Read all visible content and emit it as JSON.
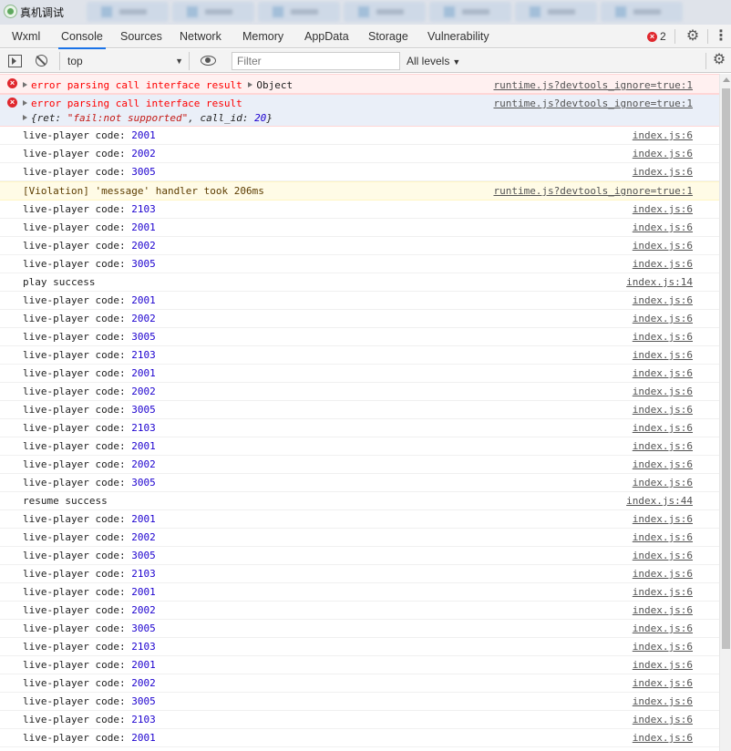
{
  "window": {
    "title": "真机调试"
  },
  "tabs": [
    {
      "label": "Wxml"
    },
    {
      "label": "Console"
    },
    {
      "label": "Sources"
    },
    {
      "label": "Network"
    },
    {
      "label": "Memory"
    },
    {
      "label": "AppData"
    },
    {
      "label": "Storage"
    },
    {
      "label": "Vulnerability"
    }
  ],
  "active_tab": "Console",
  "error_count": "2",
  "toolbar": {
    "context": "top",
    "filter_placeholder": "Filter",
    "levels": "All levels"
  },
  "messages": {
    "error1": {
      "text": "error parsing call interface result",
      "object": "Object",
      "source": "runtime.js?devtools_ignore=true:1"
    },
    "error2": {
      "text": "error parsing call interface result",
      "obj_ret_key": "ret",
      "obj_ret_val": "\"fail:not supported\"",
      "obj_callid_key": "call_id",
      "obj_callid_val": "20",
      "source": "runtime.js?devtools_ignore=true:1"
    },
    "violation": {
      "text": "[Violation] 'message' handler took 206ms",
      "source": "runtime.js?devtools_ignore=true:1"
    },
    "logs": [
      {
        "prefix": "live-player code: ",
        "code": "2001",
        "source": "index.js:6"
      },
      {
        "prefix": "live-player code: ",
        "code": "2002",
        "source": "index.js:6"
      },
      {
        "prefix": "live-player code: ",
        "code": "3005",
        "source": "index.js:6"
      },
      {
        "prefix": "live-player code: ",
        "code": "2103",
        "source": "index.js:6"
      },
      {
        "prefix": "live-player code: ",
        "code": "2001",
        "source": "index.js:6"
      },
      {
        "prefix": "live-player code: ",
        "code": "2002",
        "source": "index.js:6"
      },
      {
        "prefix": "live-player code: ",
        "code": "3005",
        "source": "index.js:6"
      },
      {
        "prefix": "play success",
        "code": "",
        "source": "index.js:14"
      },
      {
        "prefix": "live-player code: ",
        "code": "2001",
        "source": "index.js:6"
      },
      {
        "prefix": "live-player code: ",
        "code": "2002",
        "source": "index.js:6"
      },
      {
        "prefix": "live-player code: ",
        "code": "3005",
        "source": "index.js:6"
      },
      {
        "prefix": "live-player code: ",
        "code": "2103",
        "source": "index.js:6"
      },
      {
        "prefix": "live-player code: ",
        "code": "2001",
        "source": "index.js:6"
      },
      {
        "prefix": "live-player code: ",
        "code": "2002",
        "source": "index.js:6"
      },
      {
        "prefix": "live-player code: ",
        "code": "3005",
        "source": "index.js:6"
      },
      {
        "prefix": "live-player code: ",
        "code": "2103",
        "source": "index.js:6"
      },
      {
        "prefix": "live-player code: ",
        "code": "2001",
        "source": "index.js:6"
      },
      {
        "prefix": "live-player code: ",
        "code": "2002",
        "source": "index.js:6"
      },
      {
        "prefix": "live-player code: ",
        "code": "3005",
        "source": "index.js:6"
      },
      {
        "prefix": "resume success",
        "code": "",
        "source": "index.js:44"
      },
      {
        "prefix": "live-player code: ",
        "code": "2001",
        "source": "index.js:6"
      },
      {
        "prefix": "live-player code: ",
        "code": "2002",
        "source": "index.js:6"
      },
      {
        "prefix": "live-player code: ",
        "code": "3005",
        "source": "index.js:6"
      },
      {
        "prefix": "live-player code: ",
        "code": "2103",
        "source": "index.js:6"
      },
      {
        "prefix": "live-player code: ",
        "code": "2001",
        "source": "index.js:6"
      },
      {
        "prefix": "live-player code: ",
        "code": "2002",
        "source": "index.js:6"
      },
      {
        "prefix": "live-player code: ",
        "code": "3005",
        "source": "index.js:6"
      },
      {
        "prefix": "live-player code: ",
        "code": "2103",
        "source": "index.js:6"
      },
      {
        "prefix": "live-player code: ",
        "code": "2001",
        "source": "index.js:6"
      },
      {
        "prefix": "live-player code: ",
        "code": "2002",
        "source": "index.js:6"
      },
      {
        "prefix": "live-player code: ",
        "code": "3005",
        "source": "index.js:6"
      },
      {
        "prefix": "live-player code: ",
        "code": "2103",
        "source": "index.js:6"
      },
      {
        "prefix": "live-player code: ",
        "code": "2001",
        "source": "index.js:6"
      }
    ]
  },
  "colors": {
    "accent": "#1a73e8",
    "error_text": "#fe0000",
    "number": "#1c00cf",
    "error_bg": "#fff0f0",
    "violation_bg": "#fffbe6"
  }
}
